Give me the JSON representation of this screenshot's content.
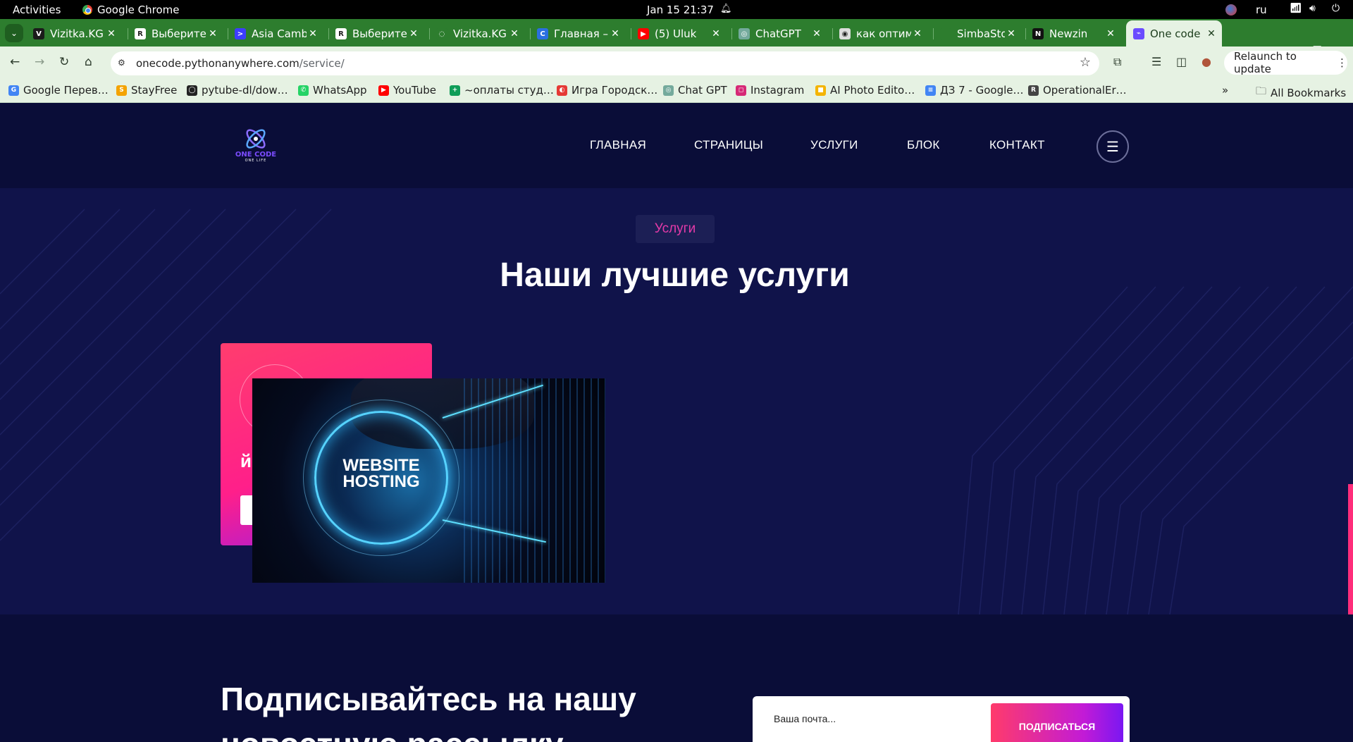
{
  "os_bar": {
    "activities": "Activities",
    "app_name": "Google Chrome",
    "clock": "Jan 15  21:37",
    "language": "ru"
  },
  "tabs": [
    {
      "title": "Vizitka.KG",
      "fav_color": "#1b1b1b",
      "fav_glyph": "V"
    },
    {
      "title": "Выберите",
      "fav_color": "#ffffff",
      "fav_glyph": "R"
    },
    {
      "title": "Asia Camb",
      "fav_color": "#3d3dff",
      "fav_glyph": ">"
    },
    {
      "title": "Выберите",
      "fav_color": "#ffffff",
      "fav_glyph": "R"
    },
    {
      "title": "Vizitka.KG",
      "fav_color": "#2d7d2e",
      "fav_glyph": "◌"
    },
    {
      "title": "Главная –",
      "fav_color": "#2b6fe0",
      "fav_glyph": "C"
    },
    {
      "title": "(5) Uluk",
      "fav_color": "#ff0000",
      "fav_glyph": "▶"
    },
    {
      "title": "ChatGPT",
      "fav_color": "#74aa9c",
      "fav_glyph": "◎"
    },
    {
      "title": "как оптим",
      "fav_color": "#dddddd",
      "fav_glyph": "◉"
    },
    {
      "title": "SimbaStor",
      "fav_color": "#2d7d2e",
      "fav_glyph": ""
    },
    {
      "title": "Newzin",
      "fav_color": "#111111",
      "fav_glyph": "N"
    },
    {
      "title": "One code",
      "fav_color": "#6b4cff",
      "fav_glyph": "⌁"
    }
  ],
  "address_bar": {
    "domain": "onecode.pythonanywhere.com",
    "path": "/service/",
    "relaunch_label": "Relaunch to update"
  },
  "bookmarks": [
    {
      "label": "Google Перев…",
      "color": "#4285f4",
      "glyph": "G"
    },
    {
      "label": "StayFree",
      "color": "#f4a300",
      "glyph": "S"
    },
    {
      "label": "pytube-dl/dow…",
      "color": "#222222",
      "glyph": "◯"
    },
    {
      "label": "WhatsApp",
      "color": "#25d366",
      "glyph": "✆"
    },
    {
      "label": "YouTube",
      "color": "#ff0000",
      "glyph": "▶"
    },
    {
      "label": "~оплаты студ…",
      "color": "#0f9d58",
      "glyph": "+"
    },
    {
      "label": "Игра Городск…",
      "color": "#e53935",
      "glyph": "◐"
    },
    {
      "label": "Chat GPT",
      "color": "#74aa9c",
      "glyph": "◎"
    },
    {
      "label": "Instagram",
      "color": "#d62976",
      "glyph": "◻"
    },
    {
      "label": "AI Photo Edito…",
      "color": "#f4b400",
      "glyph": "■"
    },
    {
      "label": "ДЗ 7 - Google…",
      "color": "#4285f4",
      "glyph": "≡"
    },
    {
      "label": "OperationalEr…",
      "color": "#444444",
      "glyph": "R"
    }
  ],
  "all_bookmarks": "All Bookmarks",
  "site": {
    "logo_text": "ONE CODE",
    "logo_sub": "ONE LIFE",
    "nav": [
      "ГЛАВНАЯ",
      "СТРАНИЦЫ",
      "УСЛУГИ",
      "БЛОК",
      "КОНТАКТ"
    ],
    "badge": "Услуги",
    "section_title": "Наши лучшие услуги",
    "card_text": "й",
    "image_text_line1": "WEBSITE",
    "image_text_line2": "HOSTING",
    "newsletter_title": "Подписывайтесь на нашу новостную рассылку",
    "email_placeholder": "Ваша почта...",
    "subscribe_label": "ПОДПИСАТЬСЯ"
  },
  "colors": {
    "accent_pink": "#ff2d7a",
    "accent_purple": "#7a17f2",
    "page_bg": "#10134a",
    "chrome_green": "#2d7d2e"
  }
}
